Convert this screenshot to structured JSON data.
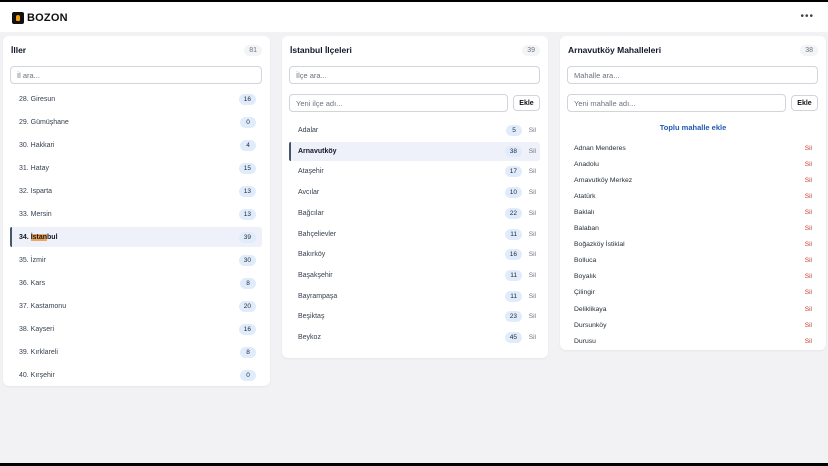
{
  "app": {
    "title": "BOZON",
    "menu_icon": "more-icon"
  },
  "provinces": {
    "title": "İller",
    "count": "81",
    "search_placeholder": "İl ara...",
    "items": [
      {
        "label": "28. Giresun",
        "count": "16"
      },
      {
        "label": "29. Gümüşhane",
        "count": "0"
      },
      {
        "label": "30. Hakkari",
        "count": "4"
      },
      {
        "label": "31. Hatay",
        "count": "15"
      },
      {
        "label": "32. Isparta",
        "count": "13"
      },
      {
        "label": "33. Mersin",
        "count": "13"
      },
      {
        "label_prefix": "34. ",
        "label_highlight": "İstan",
        "label_suffix": "bul",
        "count": "39",
        "selected": true
      },
      {
        "label": "35. İzmir",
        "count": "30"
      },
      {
        "label": "36. Kars",
        "count": "8"
      },
      {
        "label": "37. Kastamonu",
        "count": "20"
      },
      {
        "label": "38. Kayseri",
        "count": "16"
      },
      {
        "label": "39. Kırklareli",
        "count": "8"
      },
      {
        "label": "40. Kırşehir",
        "count": "0"
      }
    ]
  },
  "districts": {
    "title": "İstanbul İlçeleri",
    "count": "39",
    "search_placeholder": "İlçe ara...",
    "new_placeholder": "Yeni ilçe adı...",
    "add_label": "Ekle",
    "delete_label": "Sil",
    "items": [
      {
        "label": "Adalar",
        "count": "5"
      },
      {
        "label": "Arnavutköy",
        "count": "38",
        "selected": true
      },
      {
        "label": "Ataşehir",
        "count": "17"
      },
      {
        "label": "Avcılar",
        "count": "10"
      },
      {
        "label": "Bağcılar",
        "count": "22"
      },
      {
        "label": "Bahçelievler",
        "count": "11"
      },
      {
        "label": "Bakırköy",
        "count": "16"
      },
      {
        "label": "Başakşehir",
        "count": "11"
      },
      {
        "label": "Bayrampaşa",
        "count": "11"
      },
      {
        "label": "Beşiktaş",
        "count": "23"
      },
      {
        "label": "Beykoz",
        "count": "45"
      }
    ]
  },
  "neighborhoods": {
    "title": "Arnavutköy Mahalleleri",
    "count": "38",
    "search_placeholder": "Mahalle ara...",
    "new_placeholder": "Yeni mahalle adı...",
    "add_label": "Ekle",
    "bulk_add_label": "Toplu mahalle ekle",
    "delete_label": "Sil",
    "items": [
      {
        "label": "Adnan Menderes"
      },
      {
        "label": "Anadolu"
      },
      {
        "label": "Arnavutköy Merkez"
      },
      {
        "label": "Atatürk"
      },
      {
        "label": "Baklalı"
      },
      {
        "label": "Balaban"
      },
      {
        "label": "Boğazköy İstiklal"
      },
      {
        "label": "Bolluca"
      },
      {
        "label": "Boyalık"
      },
      {
        "label": "Çilingir"
      },
      {
        "label": "Deliklikaya"
      },
      {
        "label": "Dursunköy"
      },
      {
        "label": "Durusu"
      }
    ]
  }
}
